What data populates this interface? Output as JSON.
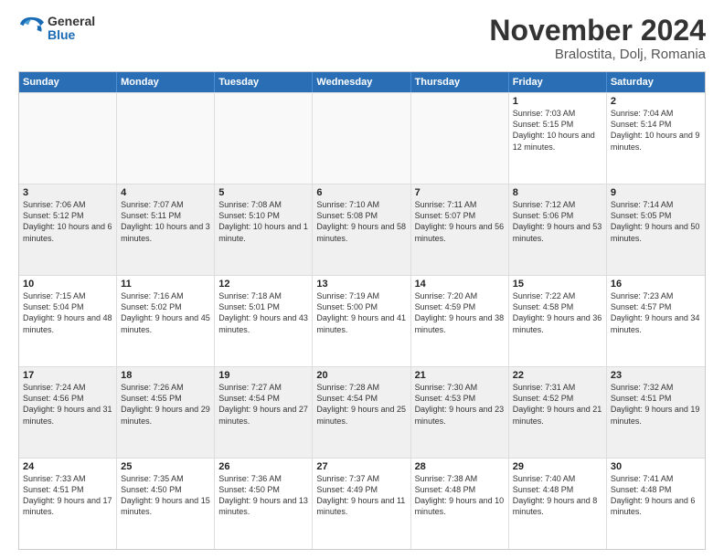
{
  "logo": {
    "general": "General",
    "blue": "Blue"
  },
  "title": {
    "month_year": "November 2024",
    "location": "Bralostita, Dolj, Romania"
  },
  "header_days": [
    "Sunday",
    "Monday",
    "Tuesday",
    "Wednesday",
    "Thursday",
    "Friday",
    "Saturday"
  ],
  "rows": [
    [
      {
        "day": "",
        "text": "",
        "empty": true
      },
      {
        "day": "",
        "text": "",
        "empty": true
      },
      {
        "day": "",
        "text": "",
        "empty": true
      },
      {
        "day": "",
        "text": "",
        "empty": true
      },
      {
        "day": "",
        "text": "",
        "empty": true
      },
      {
        "day": "1",
        "text": "Sunrise: 7:03 AM\nSunset: 5:15 PM\nDaylight: 10 hours and 12 minutes.",
        "empty": false
      },
      {
        "day": "2",
        "text": "Sunrise: 7:04 AM\nSunset: 5:14 PM\nDaylight: 10 hours and 9 minutes.",
        "empty": false
      }
    ],
    [
      {
        "day": "3",
        "text": "Sunrise: 7:06 AM\nSunset: 5:12 PM\nDaylight: 10 hours and 6 minutes.",
        "empty": false
      },
      {
        "day": "4",
        "text": "Sunrise: 7:07 AM\nSunset: 5:11 PM\nDaylight: 10 hours and 3 minutes.",
        "empty": false
      },
      {
        "day": "5",
        "text": "Sunrise: 7:08 AM\nSunset: 5:10 PM\nDaylight: 10 hours and 1 minute.",
        "empty": false
      },
      {
        "day": "6",
        "text": "Sunrise: 7:10 AM\nSunset: 5:08 PM\nDaylight: 9 hours and 58 minutes.",
        "empty": false
      },
      {
        "day": "7",
        "text": "Sunrise: 7:11 AM\nSunset: 5:07 PM\nDaylight: 9 hours and 56 minutes.",
        "empty": false
      },
      {
        "day": "8",
        "text": "Sunrise: 7:12 AM\nSunset: 5:06 PM\nDaylight: 9 hours and 53 minutes.",
        "empty": false
      },
      {
        "day": "9",
        "text": "Sunrise: 7:14 AM\nSunset: 5:05 PM\nDaylight: 9 hours and 50 minutes.",
        "empty": false
      }
    ],
    [
      {
        "day": "10",
        "text": "Sunrise: 7:15 AM\nSunset: 5:04 PM\nDaylight: 9 hours and 48 minutes.",
        "empty": false
      },
      {
        "day": "11",
        "text": "Sunrise: 7:16 AM\nSunset: 5:02 PM\nDaylight: 9 hours and 45 minutes.",
        "empty": false
      },
      {
        "day": "12",
        "text": "Sunrise: 7:18 AM\nSunset: 5:01 PM\nDaylight: 9 hours and 43 minutes.",
        "empty": false
      },
      {
        "day": "13",
        "text": "Sunrise: 7:19 AM\nSunset: 5:00 PM\nDaylight: 9 hours and 41 minutes.",
        "empty": false
      },
      {
        "day": "14",
        "text": "Sunrise: 7:20 AM\nSunset: 4:59 PM\nDaylight: 9 hours and 38 minutes.",
        "empty": false
      },
      {
        "day": "15",
        "text": "Sunrise: 7:22 AM\nSunset: 4:58 PM\nDaylight: 9 hours and 36 minutes.",
        "empty": false
      },
      {
        "day": "16",
        "text": "Sunrise: 7:23 AM\nSunset: 4:57 PM\nDaylight: 9 hours and 34 minutes.",
        "empty": false
      }
    ],
    [
      {
        "day": "17",
        "text": "Sunrise: 7:24 AM\nSunset: 4:56 PM\nDaylight: 9 hours and 31 minutes.",
        "empty": false
      },
      {
        "day": "18",
        "text": "Sunrise: 7:26 AM\nSunset: 4:55 PM\nDaylight: 9 hours and 29 minutes.",
        "empty": false
      },
      {
        "day": "19",
        "text": "Sunrise: 7:27 AM\nSunset: 4:54 PM\nDaylight: 9 hours and 27 minutes.",
        "empty": false
      },
      {
        "day": "20",
        "text": "Sunrise: 7:28 AM\nSunset: 4:54 PM\nDaylight: 9 hours and 25 minutes.",
        "empty": false
      },
      {
        "day": "21",
        "text": "Sunrise: 7:30 AM\nSunset: 4:53 PM\nDaylight: 9 hours and 23 minutes.",
        "empty": false
      },
      {
        "day": "22",
        "text": "Sunrise: 7:31 AM\nSunset: 4:52 PM\nDaylight: 9 hours and 21 minutes.",
        "empty": false
      },
      {
        "day": "23",
        "text": "Sunrise: 7:32 AM\nSunset: 4:51 PM\nDaylight: 9 hours and 19 minutes.",
        "empty": false
      }
    ],
    [
      {
        "day": "24",
        "text": "Sunrise: 7:33 AM\nSunset: 4:51 PM\nDaylight: 9 hours and 17 minutes.",
        "empty": false
      },
      {
        "day": "25",
        "text": "Sunrise: 7:35 AM\nSunset: 4:50 PM\nDaylight: 9 hours and 15 minutes.",
        "empty": false
      },
      {
        "day": "26",
        "text": "Sunrise: 7:36 AM\nSunset: 4:50 PM\nDaylight: 9 hours and 13 minutes.",
        "empty": false
      },
      {
        "day": "27",
        "text": "Sunrise: 7:37 AM\nSunset: 4:49 PM\nDaylight: 9 hours and 11 minutes.",
        "empty": false
      },
      {
        "day": "28",
        "text": "Sunrise: 7:38 AM\nSunset: 4:48 PM\nDaylight: 9 hours and 10 minutes.",
        "empty": false
      },
      {
        "day": "29",
        "text": "Sunrise: 7:40 AM\nSunset: 4:48 PM\nDaylight: 9 hours and 8 minutes.",
        "empty": false
      },
      {
        "day": "30",
        "text": "Sunrise: 7:41 AM\nSunset: 4:48 PM\nDaylight: 9 hours and 6 minutes.",
        "empty": false
      }
    ]
  ]
}
